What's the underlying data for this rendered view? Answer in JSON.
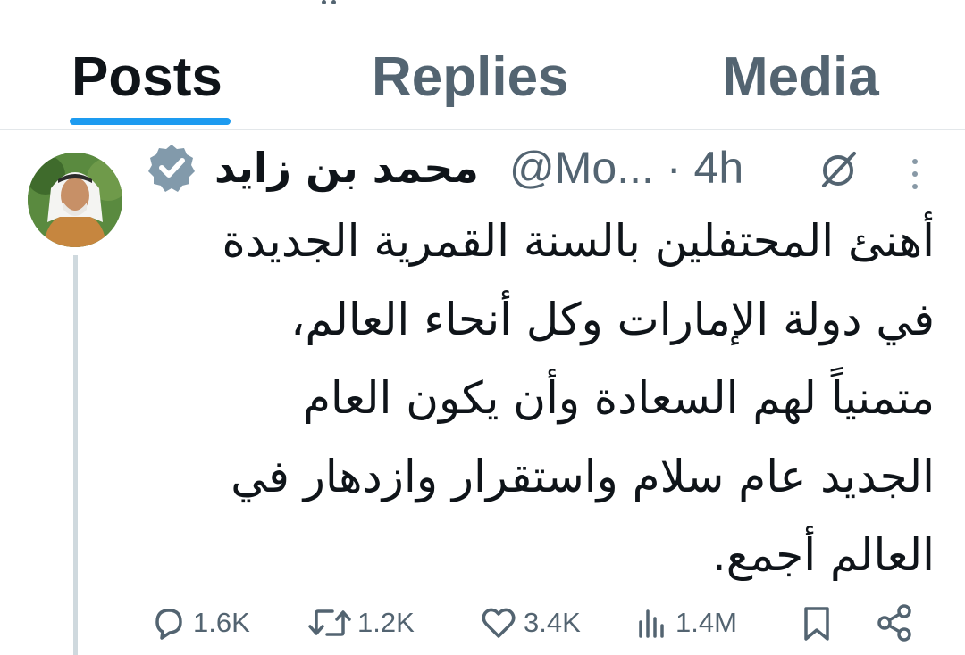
{
  "tabs": [
    {
      "label": "Posts",
      "active": true
    },
    {
      "label": "Replies",
      "active": false
    },
    {
      "label": "Media",
      "active": false
    }
  ],
  "accent_color": "#1d9bf0",
  "post": {
    "author_name": "محمد بن زايد",
    "handle": "@Mo...",
    "separator": "·",
    "time": "4h",
    "verified_badge": "gray-check-badge",
    "text_lines": [
      "أهنئ المحتفلين بالسنة القمرية الجديدة",
      "في دولة الإمارات وكل أنحاء العالم،",
      "متمنياً لهم السعادة وأن يكون العام",
      "الجديد عام سلام واستقرار وازدهار في",
      "العالم أجمع."
    ],
    "actions": {
      "replies": "1.6K",
      "reposts": "1.2K",
      "likes": "3.4K",
      "views": "1.4M"
    }
  }
}
